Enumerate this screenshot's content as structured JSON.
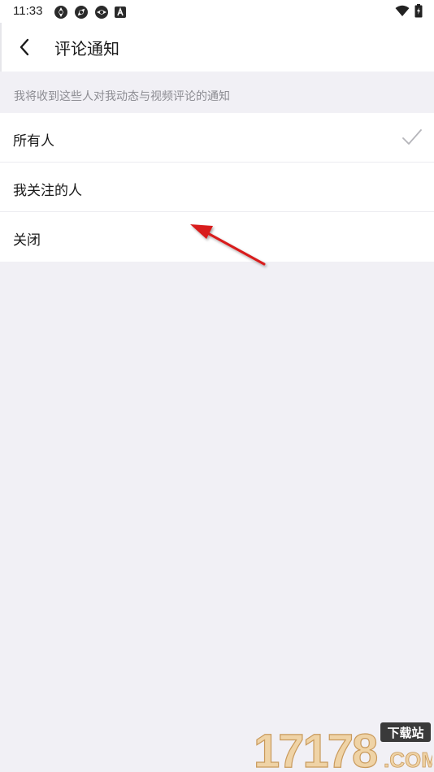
{
  "status_bar": {
    "time": "11:33",
    "icons_left": [
      "aperture-icon",
      "aperture-icon",
      "aperture-icon",
      "a-badge-icon"
    ],
    "icons_right": [
      "wifi-icon",
      "battery-charging-icon"
    ]
  },
  "header": {
    "title": "评论通知",
    "back_icon": "chevron-left-icon"
  },
  "hint": {
    "text": "我将收到这些人对我动态与视频评论的通知"
  },
  "options": [
    {
      "label": "所有人",
      "selected": true
    },
    {
      "label": "我关注的人",
      "selected": false
    },
    {
      "label": "关闭",
      "selected": false
    }
  ],
  "watermark": {
    "number": "17178",
    "tag": "下载站",
    "suffix": ".COM"
  },
  "colors": {
    "background": "#f1f0f5",
    "surface": "#ffffff",
    "check": "#b5b5ba",
    "annotation_arrow": "#d81e1e",
    "watermark_gold": "#e8c28a"
  }
}
